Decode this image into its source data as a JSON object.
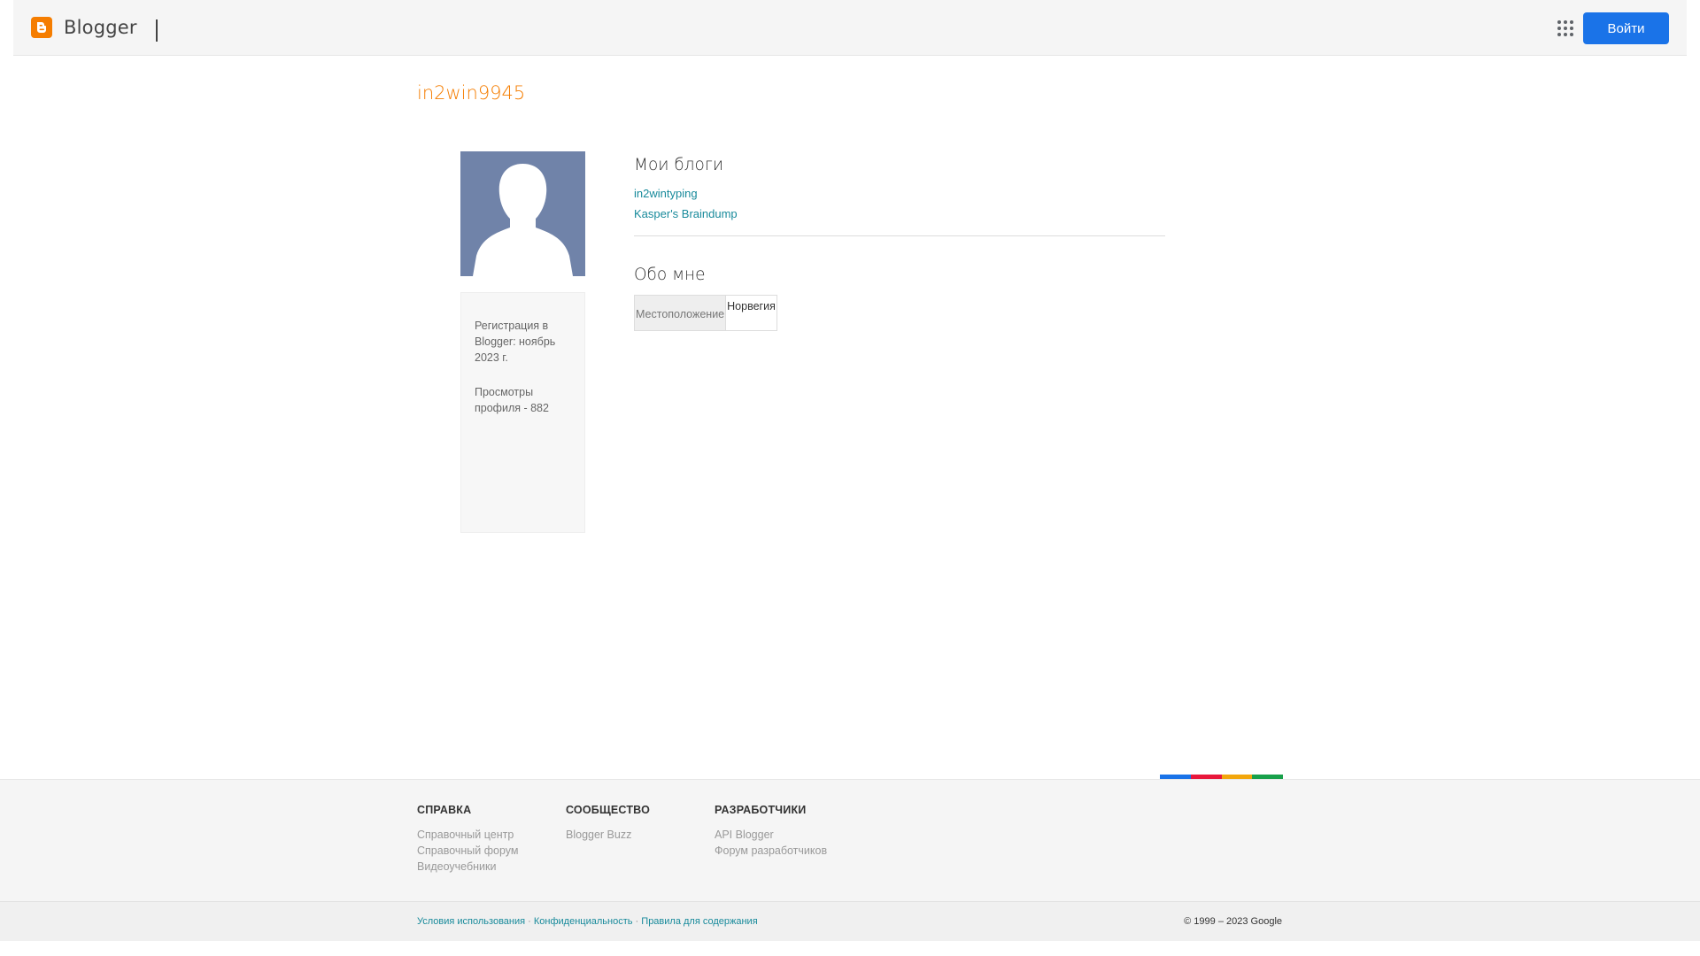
{
  "header": {
    "brand": "Blogger",
    "login_label": "Войти"
  },
  "profile": {
    "name": "in2win9945",
    "joined": "Регистрация в Blogger: ноябрь 2023 г.",
    "views": "Просмотры профиля - 882"
  },
  "blogs": {
    "title": "Мои блоги",
    "items": [
      {
        "label": "in2wintyping"
      },
      {
        "label": "Kasper's Braindump"
      }
    ]
  },
  "about": {
    "title": "Обо мне",
    "location_label": "Местоположение",
    "location_value": "Норвегия"
  },
  "footer": {
    "columns": [
      {
        "title": "СПРАВКА",
        "links": [
          "Справочный центр",
          "Справочный форум",
          "Видеоучебники"
        ]
      },
      {
        "title": "СООБЩЕСТВО",
        "links": [
          "Blogger Buzz"
        ]
      },
      {
        "title": "РАЗРАБОТЧИКИ",
        "links": [
          "API Blogger",
          "Форум разработчиков"
        ]
      }
    ],
    "legal": [
      "Условия использования",
      "Конфиденциальность",
      "Правила для содержания"
    ],
    "separator": "·",
    "copyright": "© 1999 – 2023 Google"
  },
  "colors": {
    "brand_orange": "#f57d00",
    "primary_button": "#1a73e8",
    "link": "#188a9b",
    "color_bar": [
      "#1a73e8",
      "#e8173b",
      "#f2a60c",
      "#18a04a"
    ]
  },
  "icons": [
    "blogger-logo-icon",
    "apps-grid-icon",
    "default-avatar-icon"
  ]
}
